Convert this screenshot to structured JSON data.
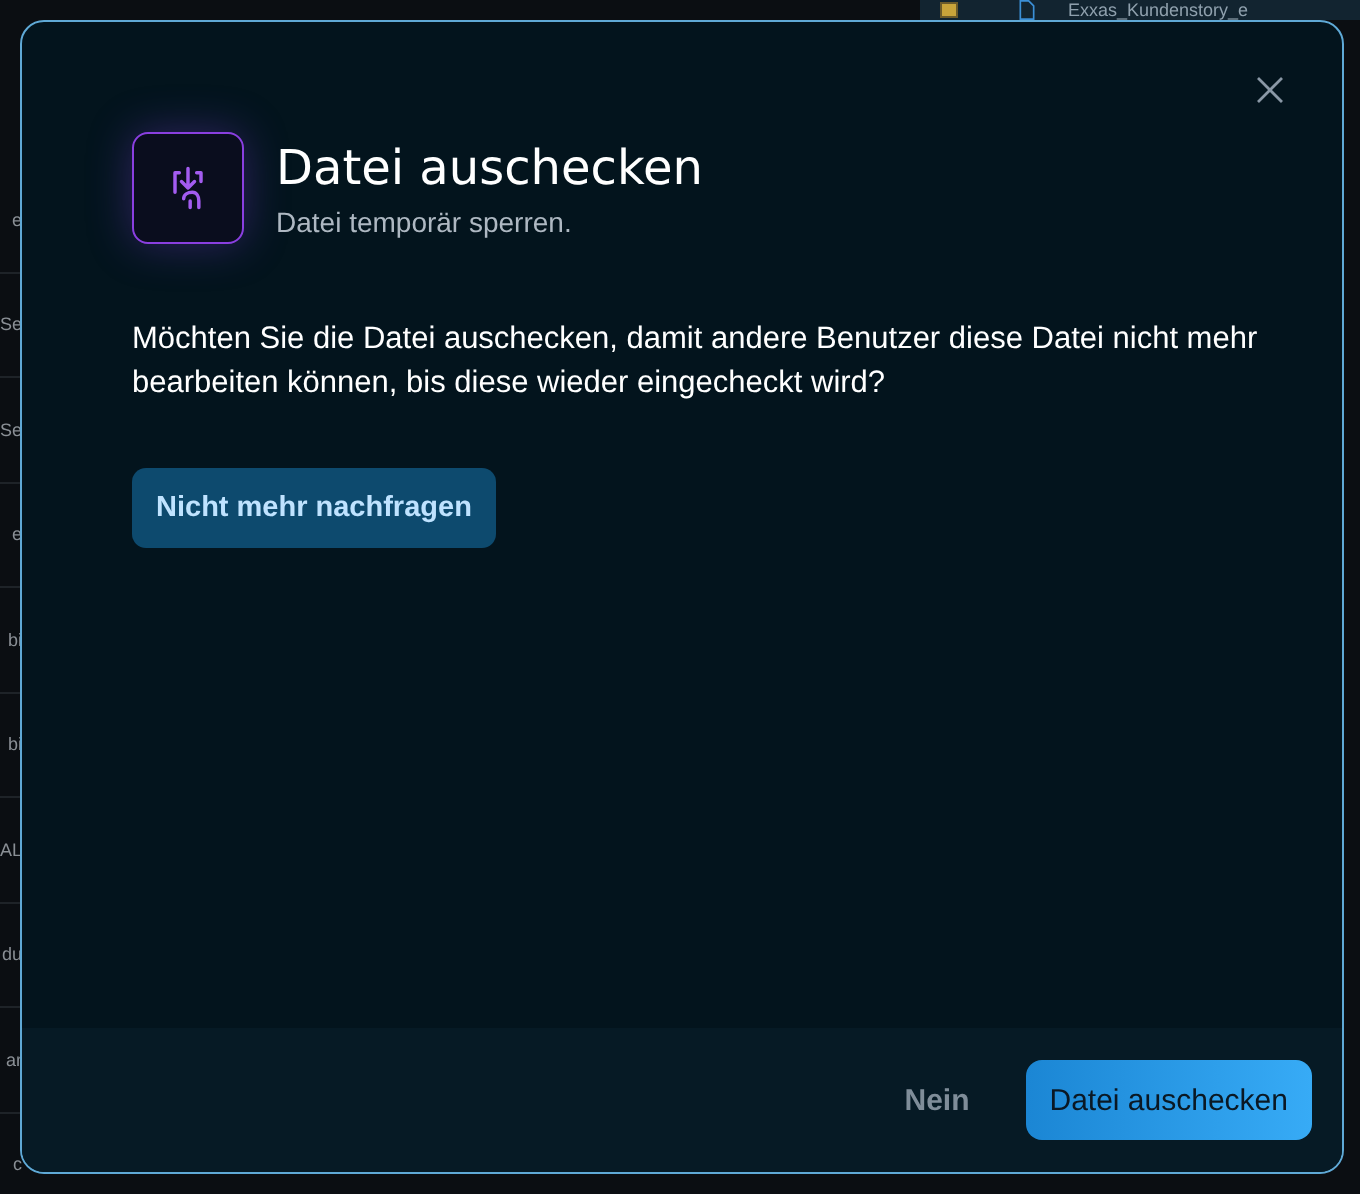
{
  "background": {
    "left_column": [
      "e",
      "Se",
      "Se",
      "e",
      "bi",
      "bi",
      "AL",
      "du",
      "ar",
      "c"
    ],
    "file_row": {
      "checked": true,
      "name": "Exxas_Kundenstory_e"
    }
  },
  "dialog": {
    "title": "Datei auschecken",
    "subtitle": "Datei temporär sperren.",
    "message": "Möchten Sie die Datei auschecken, damit andere Benutzer diese Datei nicht mehr bearbeiten können, bis diese wieder eingecheckt wird?",
    "option_button": "Nicht mehr nachfragen",
    "buttons": [
      {
        "label": "Nein",
        "kind": "secondary"
      },
      {
        "label": "Datei auschecken",
        "kind": "primary"
      }
    ]
  }
}
